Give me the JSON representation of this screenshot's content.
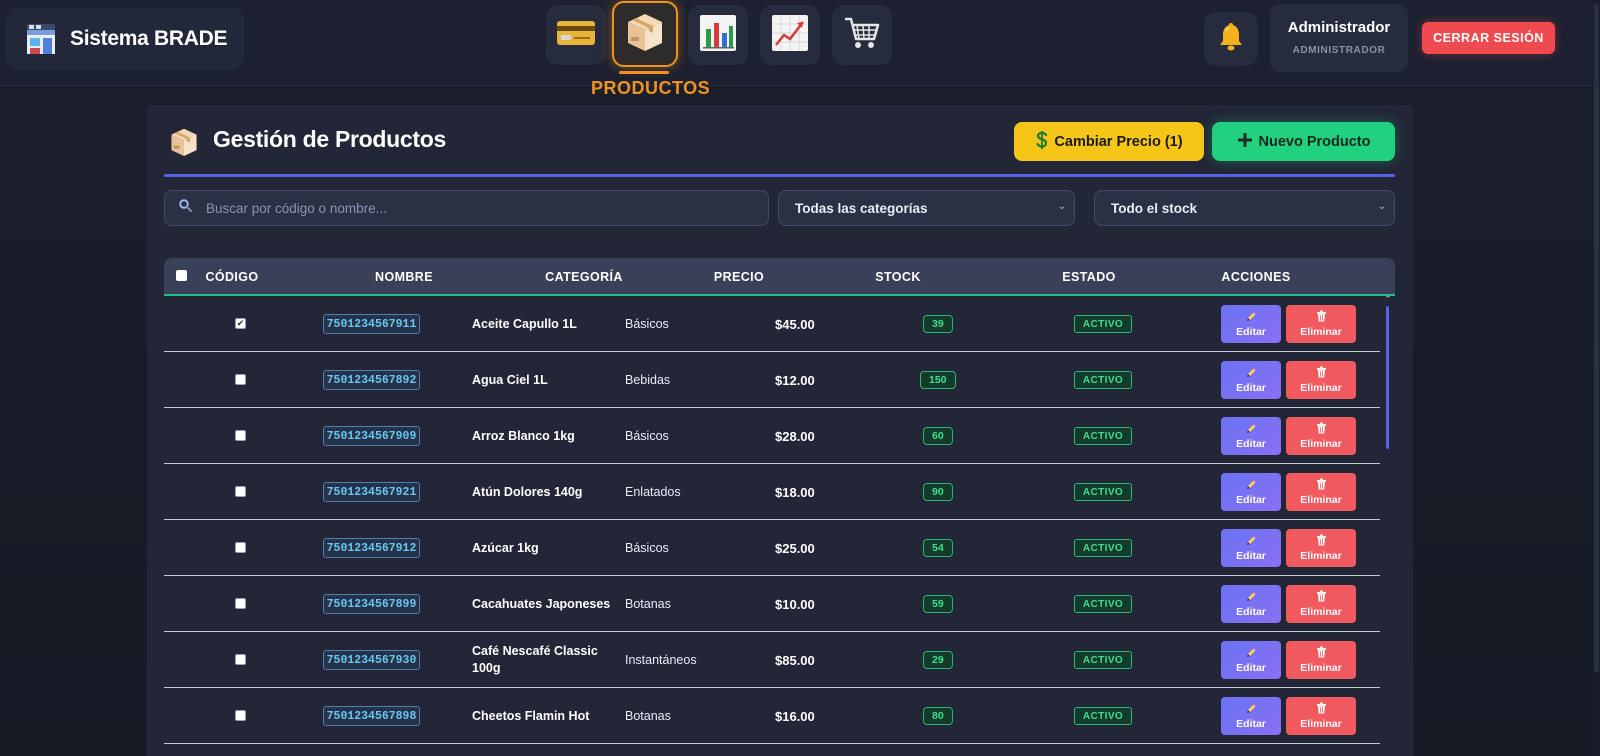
{
  "brand": {
    "title": "Sistema BRADE",
    "icon": "store-icon"
  },
  "nav": {
    "items": [
      {
        "id": "sales",
        "icon": "credit-card-icon"
      },
      {
        "id": "products",
        "icon": "box-icon",
        "active": true,
        "label": "PRODUCTOS"
      },
      {
        "id": "reports",
        "icon": "bar-chart-icon"
      },
      {
        "id": "stats",
        "icon": "line-chart-icon"
      },
      {
        "id": "cart",
        "icon": "shopping-cart-icon"
      }
    ],
    "active_label": "PRODUCTOS"
  },
  "header": {
    "bell_icon": "bell-icon",
    "user_name": "Administrador",
    "user_role": "ADMINISTRADOR",
    "logout_label": "CERRAR SESIÓN"
  },
  "panel": {
    "title": "Gestión de Productos",
    "change_price_label": "Cambiar Precio (1)",
    "new_product_label": "Nuevo Producto"
  },
  "filters": {
    "search_placeholder": "Buscar por código o nombre...",
    "category_selected": "Todas las categorías",
    "stock_selected": "Todo el stock"
  },
  "table": {
    "headers": {
      "code": "CÓDIGO",
      "name": "NOMBRE",
      "category": "CATEGORÍA",
      "price": "PRECIO",
      "stock": "STOCK",
      "status": "ESTADO",
      "actions": "ACCIONES"
    },
    "edit_label": "Editar",
    "delete_label": "Eliminar",
    "rows": [
      {
        "checked": true,
        "code": "7501234567911",
        "name": "Aceite Capullo 1L",
        "category": "Básicos",
        "price": "$45.00",
        "stock": "39",
        "status": "ACTIVO"
      },
      {
        "checked": false,
        "code": "7501234567892",
        "name": "Agua Ciel 1L",
        "category": "Bebidas",
        "price": "$12.00",
        "stock": "150",
        "status": "ACTIVO"
      },
      {
        "checked": false,
        "code": "7501234567909",
        "name": "Arroz Blanco 1kg",
        "category": "Básicos",
        "price": "$28.00",
        "stock": "60",
        "status": "ACTIVO"
      },
      {
        "checked": false,
        "code": "7501234567921",
        "name": "Atún Dolores 140g",
        "category": "Enlatados",
        "price": "$18.00",
        "stock": "90",
        "status": "ACTIVO"
      },
      {
        "checked": false,
        "code": "7501234567912",
        "name": "Azúcar 1kg",
        "category": "Básicos",
        "price": "$25.00",
        "stock": "54",
        "status": "ACTIVO"
      },
      {
        "checked": false,
        "code": "7501234567899",
        "name": "Cacahuates Japoneses",
        "category": "Botanas",
        "price": "$10.00",
        "stock": "59",
        "status": "ACTIVO"
      },
      {
        "checked": false,
        "code": "7501234567930",
        "name": "Café Nescafé Classic 100g",
        "category": "Instantáneos",
        "price": "$85.00",
        "stock": "29",
        "status": "ACTIVO"
      },
      {
        "checked": false,
        "code": "7501234567898",
        "name": "Cheetos Flamin Hot",
        "category": "Botanas",
        "price": "$16.00",
        "stock": "80",
        "status": "ACTIVO"
      }
    ]
  },
  "colors": {
    "accent_orange": "#f0931e",
    "accent_blue": "#5663e8",
    "success_green": "#22d17f",
    "warning_yellow": "#f5c518",
    "danger_red": "#ef4a4f"
  }
}
